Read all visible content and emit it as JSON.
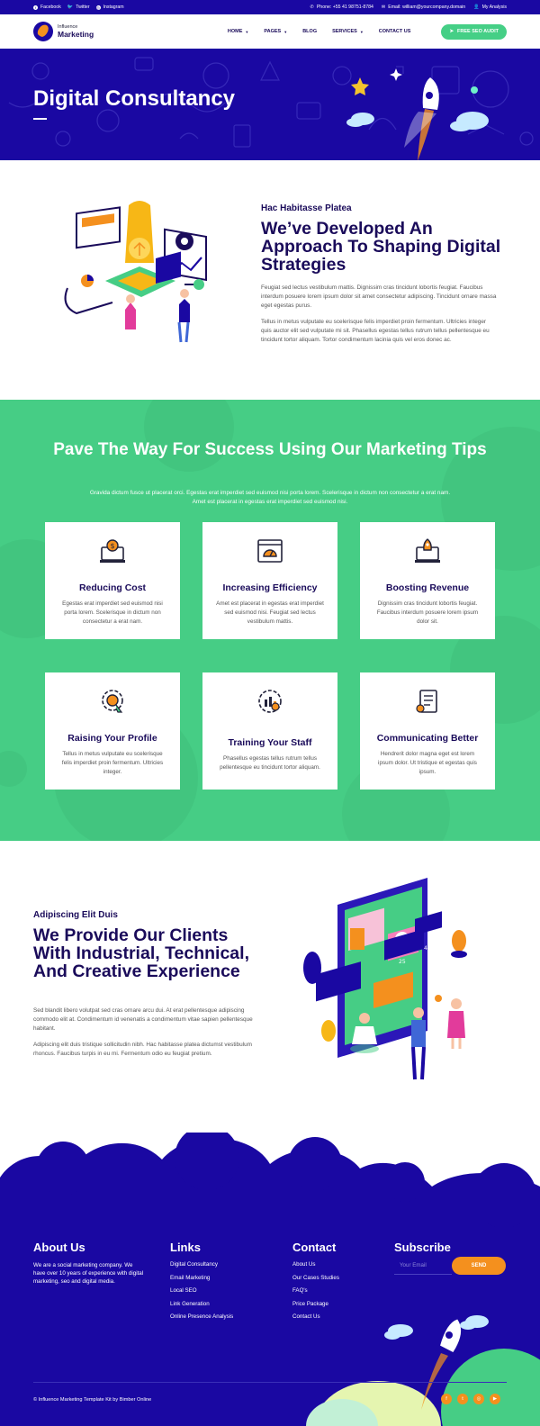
{
  "topbar": {
    "facebook": "Facebook",
    "twitter": "Twitter",
    "instagram": "Instagram",
    "phone": "Phone: +55 41 98751-8784",
    "email": "Email: william@yourcompany.domain",
    "account": "My Analysis"
  },
  "nav": {
    "logo_small": "Influence",
    "logo_big": "Marketing",
    "items": [
      "HOME",
      "PAGES",
      "BLOG",
      "SERVICES",
      "CONTACT US"
    ],
    "cta": "FREE SEO AUDIT"
  },
  "hero": {
    "title": "Digital Consultancy"
  },
  "intro": {
    "eyebrow": "Hac Habitasse Platea",
    "heading": "We’ve Developed An Approach To Shaping Digital Strategies",
    "p1": "Feugiat sed lectus vestibulum mattis. Dignissim cras tincidunt lobortis feugiat. Faucibus interdum posuere lorem ipsum dolor sit amet consectetur adipiscing. Tincidunt ornare massa eget egestas purus.",
    "p2": "Tellus in metus vulputate eu scelerisque felis imperdiet proin fermentum. Ultricies integer quis auctor elit sed vulputate mi sit. Phasellus egestas tellus rutrum tellus pellentesque eu tincidunt tortor aliquam. Tortor condimentum lacinia quis vel eros donec ac."
  },
  "tips": {
    "heading": "Pave The Way For Success Using Our Marketing Tips",
    "sub": "Gravida dictum fusce ut placerat orci. Egestas erat imperdiet sed euismod nisi porta lorem. Scelerisque in dictum non consectetur a erat nam. Amet est placerat in egestas erat imperdiet sed euismod nisi.",
    "cards": [
      {
        "title": "Reducing Cost",
        "text": "Egestas erat imperdiet sed euismod nisi porta lorem. Scelerisque in dictum non consectetur a erat nam.",
        "icon": "money-laptop-icon"
      },
      {
        "title": "Increasing Efficiency",
        "text": "Amet est placerat in egestas erat imperdiet sed euismod nisi. Feugiat sed lectus vestibulum mattis.",
        "icon": "speedometer-browser-icon"
      },
      {
        "title": "Boosting Revenue",
        "text": "Dignissim cras tincidunt lobortis feugiat. Faucibus interdum posuere lorem ipsum dolor sit.",
        "icon": "rocket-laptop-icon"
      },
      {
        "title": "Raising Your Profile",
        "text": "Tellus in metus vulputate eu scelerisque felis imperdiet proin fermentum. Ultricies integer.",
        "icon": "gear-badge-icon"
      },
      {
        "title": "Training Your Staff",
        "text": "Phasellus egestas tellus rutrum tellus pellentesque eu tincidunt tortor aliquam.",
        "icon": "team-chart-icon"
      },
      {
        "title": "Communicating Better",
        "text": "Hendrerit dolor magna eget est lorem ipsum dolor. Ut tristique et egestas quis ipsum.",
        "icon": "document-scroll-icon"
      }
    ]
  },
  "clients": {
    "eyebrow": "Adipiscing Elit Duis",
    "heading": "We Provide Our Clients With Industrial, Technical, And Creative Experience",
    "p1": "Sed blandit libero volutpat sed cras ornare arcu dui. At erat pellentesque adipiscing commodo elit at. Condimentum id venenatis a condimentum vitae sapien pellentesque habitant.",
    "p2": "Adipiscing elit duis tristique sollicitudin nibh. Hac habitasse platea dictumst vestibulum rhoncus. Faucibus turpis in eu mi. Fermentum odio eu feugiat pretium.",
    "stats": [
      "25",
      "42"
    ]
  },
  "footer": {
    "about_title": "About Us",
    "about_text": "We are a social marketing company. We have over 10 years of experience with digital marketing, seo and digital media.",
    "links_title": "Links",
    "links": [
      "Digital Consultancy",
      "Email Marketing",
      "Local SEO",
      "Link Generation",
      "Online Presence Analysis"
    ],
    "contact_title": "Contact",
    "contact": [
      "About Us",
      "Our Cases Studies",
      "FAQ's",
      "Price Package",
      "Contact Us"
    ],
    "subscribe_title": "Subscribe",
    "email_placeholder": "Your Email",
    "send": "SEND",
    "copyright": "© Influence Marketing Template Kit by Bimber Online"
  },
  "colors": {
    "primary": "#1a08a2",
    "green": "#46cd85",
    "orange": "#f4901e",
    "heading": "#1a0b5a"
  }
}
